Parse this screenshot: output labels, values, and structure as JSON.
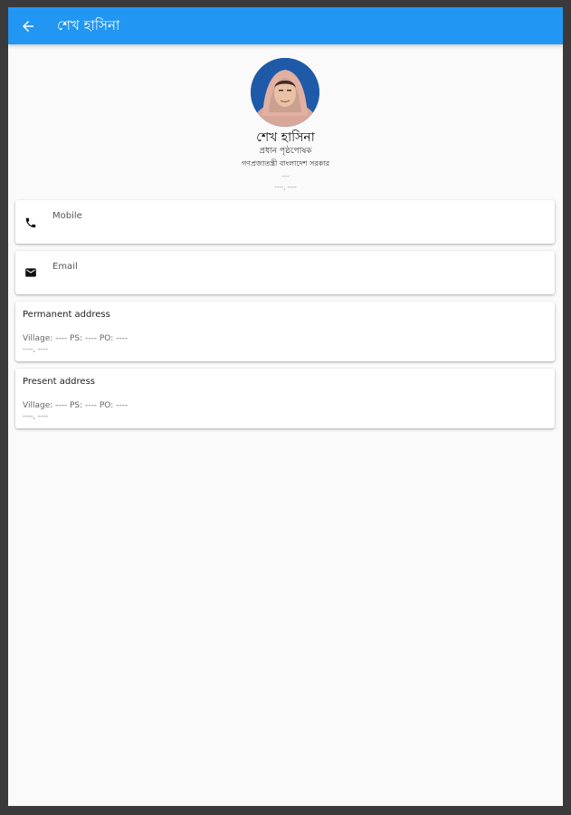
{
  "appbar": {
    "title": "শেখ হাসিনা",
    "back_icon": "arrow-back-icon",
    "color": "#2196f3"
  },
  "profile": {
    "name": "শেখ হাসিনা",
    "designation": "প্রধান পৃষ্ঠপোষক",
    "organization": "গণপ্রজাতন্ত্রী বাংলাদেশ সরকার",
    "dash": "---",
    "extra": "----, ----"
  },
  "contact": {
    "mobile_label": "Mobile",
    "mobile_icon": "phone-icon",
    "email_label": "Email",
    "email_icon": "mail-icon"
  },
  "permanent_address": {
    "title": "Permanent address",
    "line1": "Village: ---- PS: ---- PO: ----",
    "line2": "----, ----"
  },
  "present_address": {
    "title": "Present address",
    "line1": "Village: ---- PS: ---- PO: ----",
    "line2": "----, ----"
  }
}
